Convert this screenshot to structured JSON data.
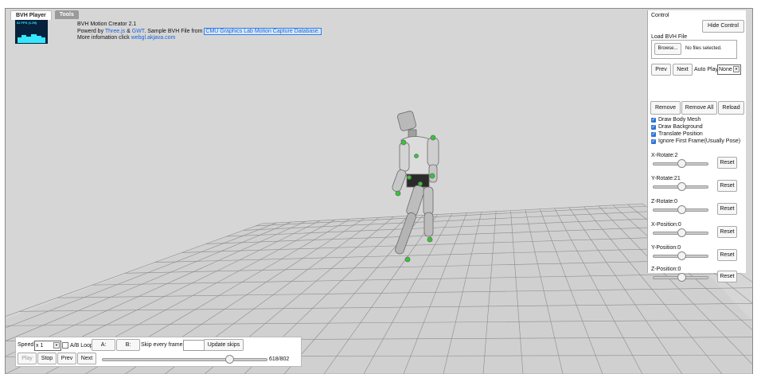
{
  "tabs": [
    {
      "label": "BVH Player"
    },
    {
      "label": "Tools"
    }
  ],
  "stats": {
    "label": "62 FPS (1-59)"
  },
  "info": {
    "line1": "BVH Motion Creator 2.1",
    "line2_prefix": "Powerd by ",
    "threejs": "Three.js",
    "amp": " & ",
    "gwt": "GWT",
    "line2_mid": ". Sample BVH File from ",
    "cmu": "CMU Graphics Lab Motion Capture Database.",
    "line3_prefix": "More infomation click ",
    "link": "webgl.akjava.com"
  },
  "panel": {
    "title": "Control",
    "hide_btn": "Hide Control",
    "load_label": "Load BVH File",
    "browse_btn": "Browse...",
    "no_files": "No files selected.",
    "prev_btn": "Prev",
    "next_btn": "Next",
    "auto_play_label": "Auto Play",
    "auto_play_value": "None",
    "remove_btn": "Remove",
    "remove_all_btn": "Remove All",
    "reload_btn": "Reload",
    "checks": [
      "Draw Body Mesh",
      "Draw Background",
      "Translate Position",
      "Ignore First Frame(Usually Pose)"
    ],
    "sliders": [
      {
        "label": "X-Rotate:2",
        "value": 2
      },
      {
        "label": "Y-Rotate:21",
        "value": 21
      },
      {
        "label": "Z-Rotate:0",
        "value": 0
      },
      {
        "label": "X-Position:0",
        "value": 0
      },
      {
        "label": "Y-Position:0",
        "value": 0
      },
      {
        "label": "Z-Position:0",
        "value": 0
      }
    ],
    "reset_btn": "Reset"
  },
  "bottom": {
    "speed_label": "Speed",
    "speed_value": "x 1",
    "ab_loop": "A/B Loop",
    "a_btn": "A:",
    "b_btn": "B:",
    "skip_label": "Skip every frame:",
    "update_btn": "Update skips",
    "play_btn": "Play",
    "stop_btn": "Stop",
    "prev_btn": "Prev",
    "next_btn": "Next",
    "frame_text": "618/802",
    "current_frame": 618,
    "total_frames": 802
  }
}
